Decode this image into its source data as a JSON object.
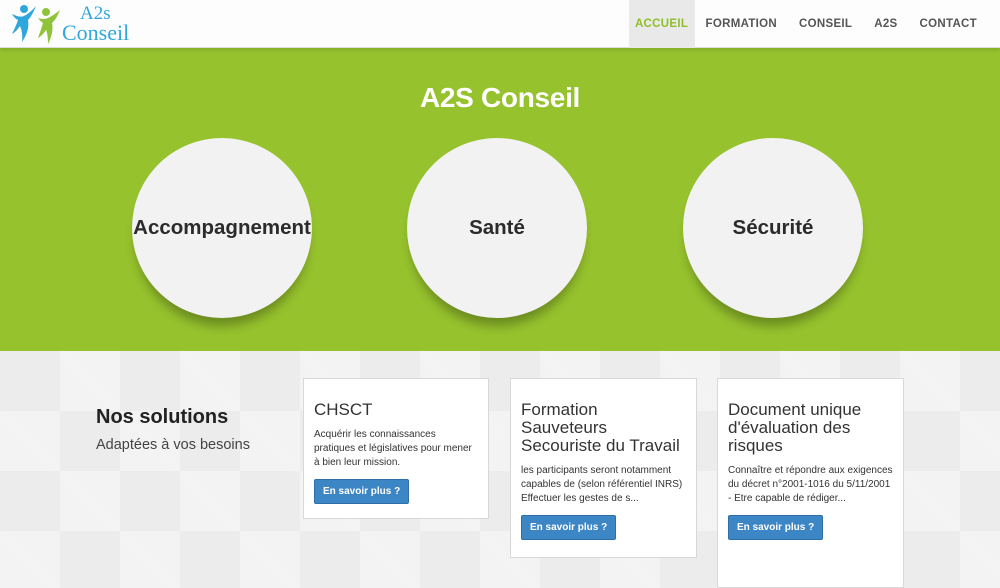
{
  "logo": {
    "line1": "A2s",
    "line2": "Conseil",
    "figure_colors": [
      "#2fa7dd",
      "#8fc43a"
    ]
  },
  "nav": {
    "items": [
      {
        "label": "ACCUEIL",
        "active": true
      },
      {
        "label": "FORMATION",
        "active": false
      },
      {
        "label": "CONSEIL",
        "active": false
      },
      {
        "label": "A2S",
        "active": false
      },
      {
        "label": "CONTACT",
        "active": false
      }
    ],
    "active_color": "#8fbe2a"
  },
  "hero": {
    "title": "A2S Conseil",
    "background": "#96c22d",
    "circles": [
      "Accompagnement",
      "Santé",
      "Sécurité"
    ]
  },
  "solutions": {
    "title": "Nos solutions",
    "subtitle": "Adaptées à vos besoins"
  },
  "cards": [
    {
      "title": "CHSCT",
      "text": "Acquérir les connaissances pratiques et législatives pour mener à bien leur mission.",
      "button": "En savoir plus ?"
    },
    {
      "title": "Formation Sauveteurs Secouriste du Travail",
      "text": "les participants seront notamment capables de (selon référentiel INRS) Effectuer les gestes de s...",
      "button": "En savoir plus ?"
    },
    {
      "title": "Document unique d'évaluation des risques",
      "text": "Connaître et répondre aux exigences du décret n°2001-1016 du 5/11/2001 - Etre capable de rédiger...",
      "button": "En savoir plus ?"
    }
  ],
  "button_color": "#3d86c6"
}
